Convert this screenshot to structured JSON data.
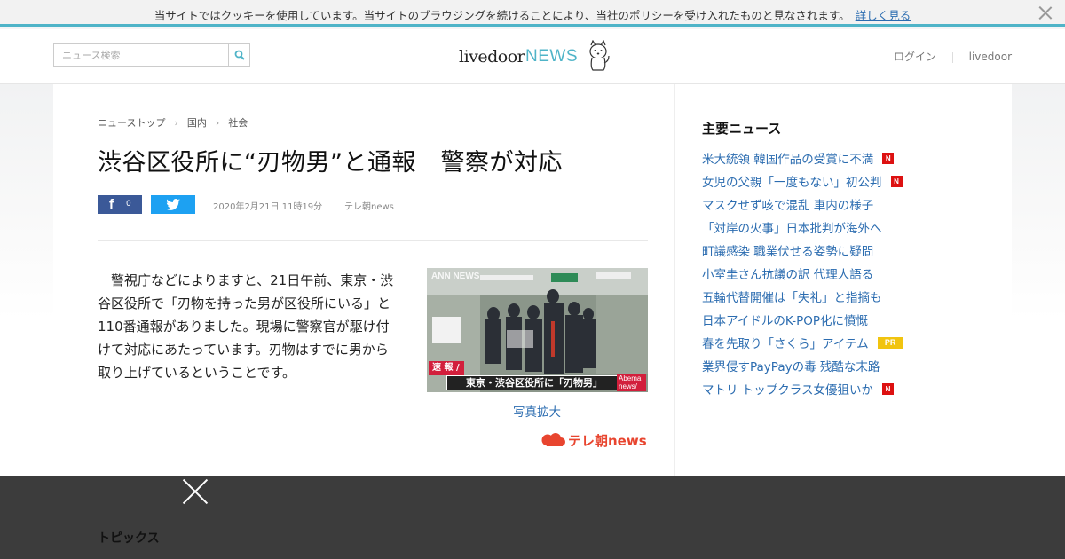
{
  "cookie_bar": {
    "text": "当サイトではクッキーを使用しています。当サイトのブラウジングを続けることにより、当社のポリシーを受け入れたものと見なされます。",
    "link": "詳しく見る"
  },
  "header": {
    "search_placeholder": "ニュース検索",
    "logo_livedoor": "livedoor",
    "logo_news": "NEWS",
    "nav": [
      "ログイン",
      "livedoor"
    ]
  },
  "breadcrumb": [
    "ニューストップ",
    "国内",
    "社会"
  ],
  "article": {
    "title": "渋谷区役所に“刃物男”と通報　警察が対応",
    "fb_count": "0",
    "date": "2020年2月21日 11時19分",
    "source": "テレ朝news",
    "body": "警視庁などによりますと、21日午前、東京・渋谷区役所で「刃物を持った男が区役所にいる」と110番通報がありました。現場に警察官が駆け付けて対応にあたっています。刃物はすでに男から取り上げているということです。",
    "photo_caption": "東京・渋谷区役所に「刃物男」",
    "photo_urgent": "速 報 /",
    "photo_logo": "ANN NEWS",
    "photo_abema": "Abema news/",
    "photo_zoom": "写真拡大",
    "source_logo": "テレ朝news"
  },
  "sidebar": {
    "heading": "主要ニュース",
    "items": [
      {
        "text": "米大統領 韓国作品の受賞に不満",
        "badge": "N"
      },
      {
        "text": "女児の父親「一度もない」初公判",
        "badge": "N"
      },
      {
        "text": "マスクせず咳で混乱 車内の様子",
        "badge": ""
      },
      {
        "text": "「対岸の火事」日本批判が海外へ",
        "badge": ""
      },
      {
        "text": "町議感染 職業伏せる姿勢に疑問",
        "badge": ""
      },
      {
        "text": "小室圭さん抗議の訳 代理人語る",
        "badge": ""
      },
      {
        "text": "五輪代替開催は「失礼」と指摘も",
        "badge": ""
      },
      {
        "text": "日本アイドルのK-POP化に憤慨",
        "badge": ""
      },
      {
        "text": "春を先取り「さくら」アイテム",
        "badge": "PR"
      },
      {
        "text": "業界侵すPayPayの毒 残酷な末路",
        "badge": ""
      },
      {
        "text": "マトリ トップクラス女優狙いか",
        "badge": "N"
      }
    ]
  },
  "bottom": {
    "topics": "トピックス"
  },
  "colors": {
    "accent": "#4fb4c8",
    "link": "#2b6cb0",
    "facebook": "#3b5998",
    "twitter": "#1da1f2",
    "badge_new": "#dd1111",
    "badge_pr": "#f1c40f"
  }
}
